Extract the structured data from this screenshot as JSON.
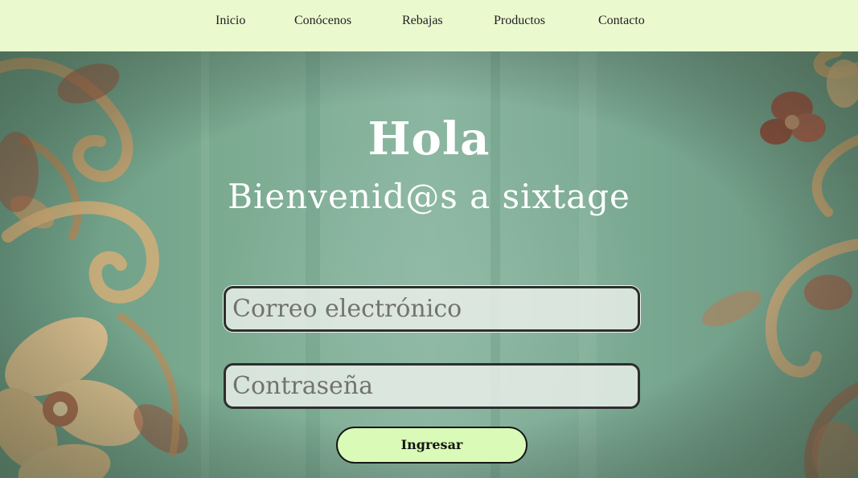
{
  "nav": {
    "items": [
      {
        "label": "Inicio"
      },
      {
        "label": "Conócenos"
      },
      {
        "label": "Rebajas"
      },
      {
        "label": "Productos"
      },
      {
        "label": "Contacto"
      }
    ]
  },
  "hero": {
    "title": "Hola",
    "subtitle": "Bienvenid@s a sixtage"
  },
  "login": {
    "email_placeholder": "Correo electrónico",
    "password_placeholder": "Contraseña",
    "submit_label": "Ingresar"
  },
  "colors": {
    "nav_background": "#ebf9cf",
    "button_background": "#d9fbb7",
    "hero_teal": "#7aaa90",
    "floral_cream": "#e2c08c",
    "floral_red": "#9c4f3c"
  }
}
